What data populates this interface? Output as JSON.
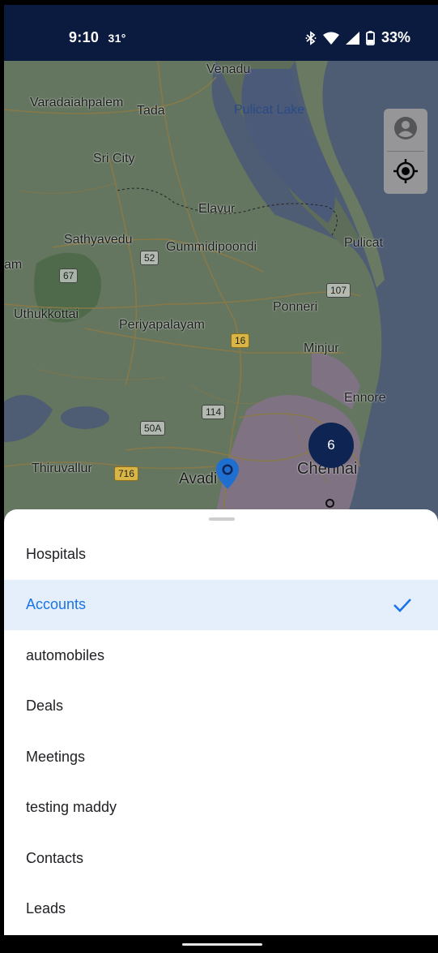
{
  "status_bar": {
    "time": "9:10",
    "temperature": "31°",
    "battery": "33%",
    "icons": [
      "bluetooth-icon",
      "wifi-icon",
      "cellular-signal-icon",
      "battery-icon"
    ]
  },
  "map": {
    "labels": {
      "venadu": "Venadu",
      "varadaiahpalem": "Varadaiahpalem",
      "tada": "Tada",
      "pulicat_lake": "Pulicat Lake",
      "sri_city": "Sri City",
      "elavur": "Elavur",
      "sathyavedu": "Sathyavedu",
      "gummidipoondi": "Gummidipoondi",
      "pulicat": "Pulicat",
      "am": "am",
      "uthukkottai": "Uthukkottai",
      "ponneri": "Ponneri",
      "periyapalayam": "Periyapalayam",
      "minjur": "Minjur",
      "ennore": "Ennore",
      "thiruvallur": "Thiruvallur",
      "avadi": "Avadi",
      "chennai": "Chennai"
    },
    "shields": {
      "s67": "67",
      "s52": "52",
      "s107": "107",
      "s16": "16",
      "s114": "114",
      "s50a": "50A",
      "s716": "716"
    },
    "cluster_count": "6",
    "controls": [
      "profile-icon",
      "my-location-icon"
    ]
  },
  "sheet": {
    "items": [
      {
        "label": "Hospitals",
        "selected": false
      },
      {
        "label": "Accounts",
        "selected": true
      },
      {
        "label": "automobiles",
        "selected": false
      },
      {
        "label": "Deals",
        "selected": false
      },
      {
        "label": "Meetings",
        "selected": false
      },
      {
        "label": "testing maddy",
        "selected": false
      },
      {
        "label": "Contacts",
        "selected": false
      },
      {
        "label": "Leads",
        "selected": false
      }
    ]
  },
  "colors": {
    "status_bar_bg": "#0b1b3f",
    "accent": "#1a73e8",
    "selected_row_bg": "#e5effc",
    "cluster_bg": "#0e2553"
  }
}
